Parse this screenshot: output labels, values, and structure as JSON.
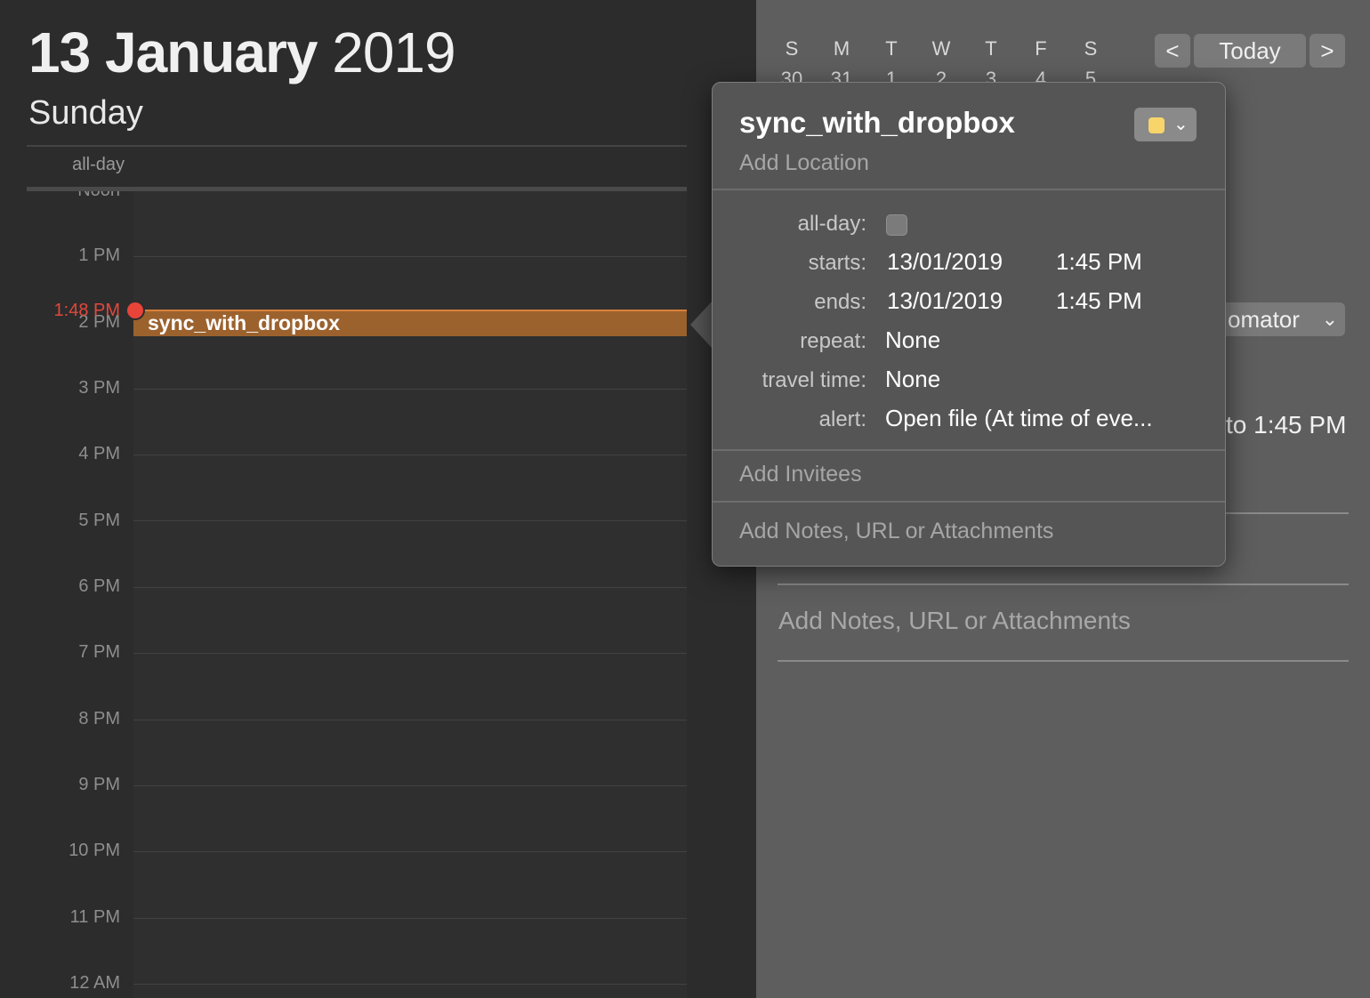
{
  "header": {
    "day_month": "13 January",
    "year": "2019",
    "weekday": "Sunday",
    "allday_label": "all-day"
  },
  "timeline": {
    "hours": [
      {
        "label": "Noon"
      },
      {
        "label": "1 PM"
      },
      {
        "label": "2 PM"
      },
      {
        "label": "3 PM"
      },
      {
        "label": "4 PM"
      },
      {
        "label": "5 PM"
      },
      {
        "label": "6 PM"
      },
      {
        "label": "7 PM"
      },
      {
        "label": "8 PM"
      },
      {
        "label": "9 PM"
      },
      {
        "label": "10 PM"
      },
      {
        "label": "11 PM"
      },
      {
        "label": "12 AM"
      }
    ],
    "current_time": "1:48 PM",
    "event": {
      "title": "sync_with_dropbox"
    }
  },
  "mini_calendar": {
    "weekdays": [
      "S",
      "M",
      "T",
      "W",
      "T",
      "F",
      "S"
    ],
    "first_row": [
      "30",
      "31",
      "1",
      "2",
      "3",
      "4",
      "5"
    ]
  },
  "navigation": {
    "prev_icon": "<",
    "today_label": "Today",
    "next_icon": ">"
  },
  "inspector": {
    "calendar_select_text": "omator",
    "time_text": "to 1:45 PM",
    "notes_placeholder": "Add Notes, URL or Attachments"
  },
  "popover": {
    "title": "sync_with_dropbox",
    "location_placeholder": "Add Location",
    "color": "#f7d56b",
    "fields": {
      "allday_label": "all-day:",
      "starts_label": "starts:",
      "starts_date": "13/01/2019",
      "starts_time": "1:45 PM",
      "ends_label": "ends:",
      "ends_date": "13/01/2019",
      "ends_time": "1:45 PM",
      "repeat_label": "repeat:",
      "repeat_value": "None",
      "travel_label": "travel time:",
      "travel_value": "None",
      "alert_label": "alert:",
      "alert_value": "Open file (At time of eve..."
    },
    "invitees_placeholder": "Add Invitees",
    "notes_placeholder": "Add Notes, URL or Attachments"
  }
}
